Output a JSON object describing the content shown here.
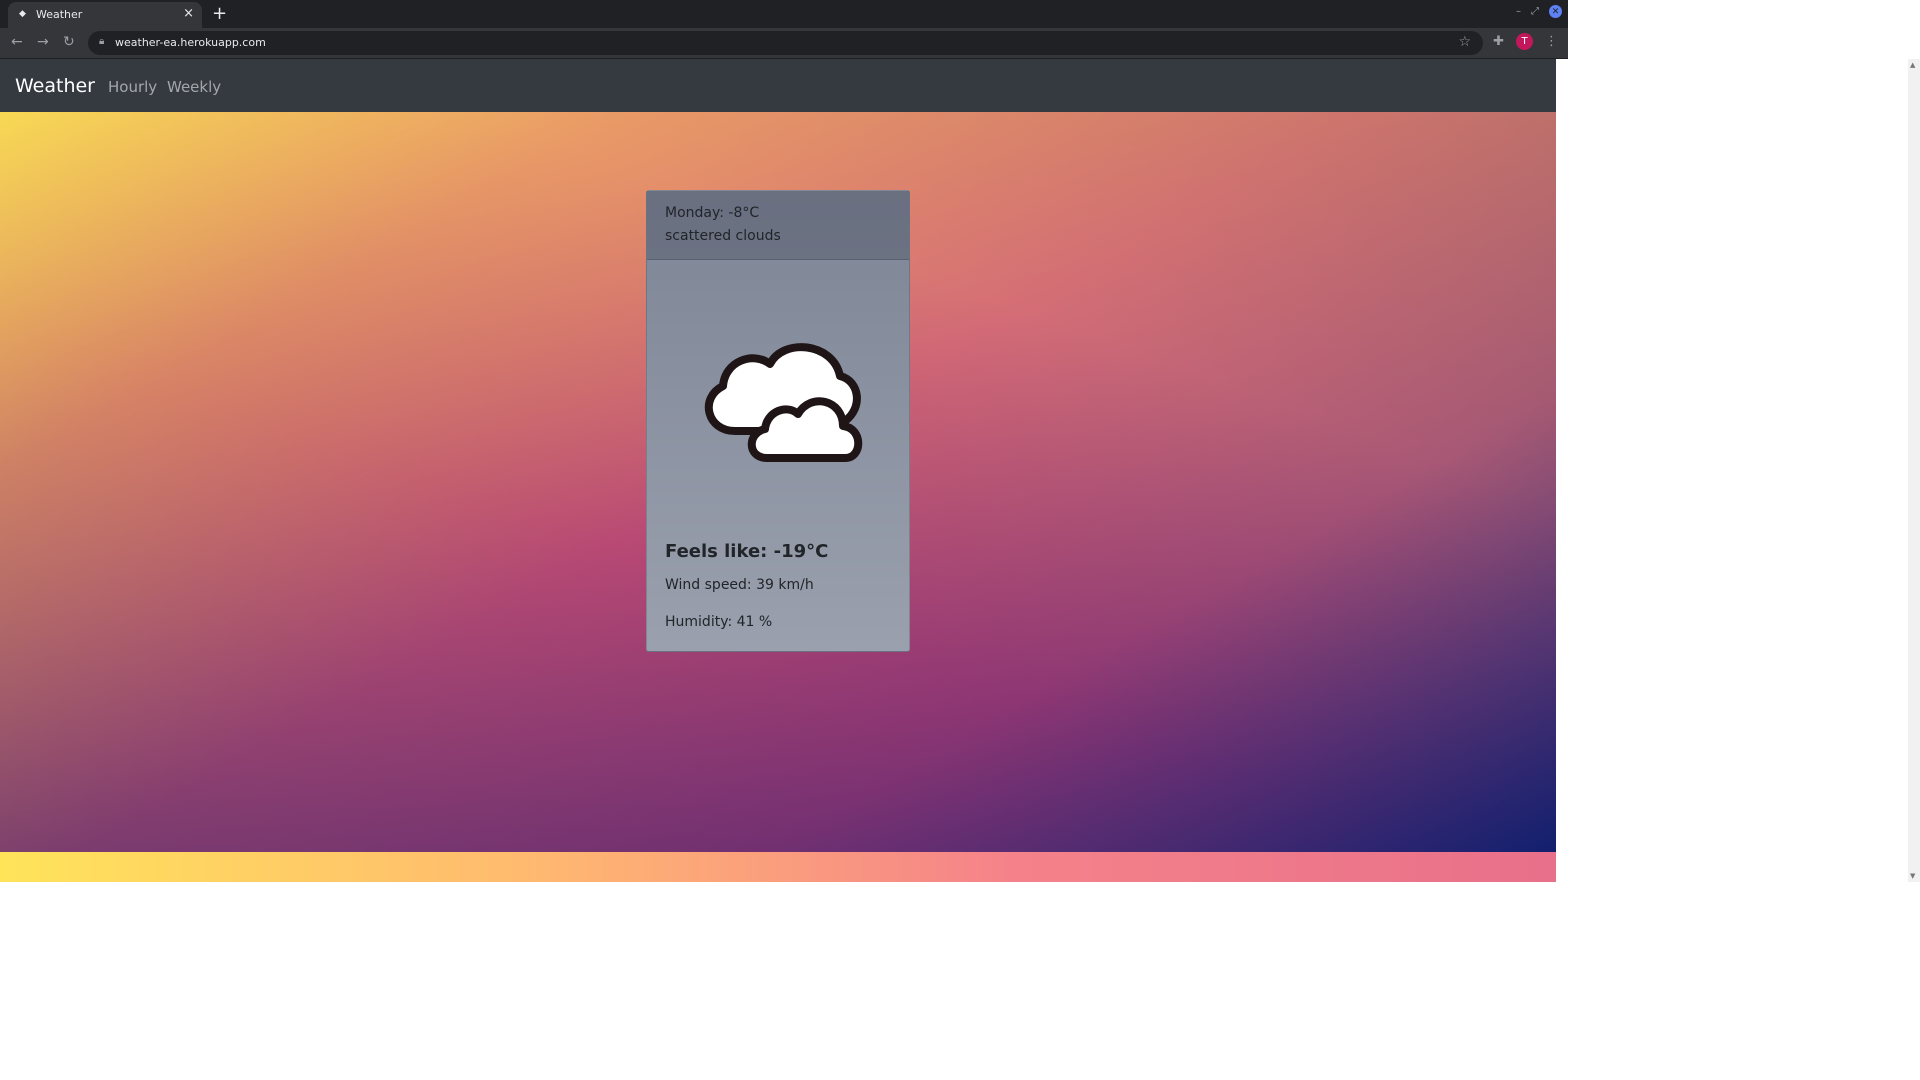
{
  "browser": {
    "tab_title": "Weather",
    "tab_close": "×",
    "new_tab": "+",
    "url": "weather-ea.herokuapp.com",
    "profile_initial": "T"
  },
  "navbar": {
    "brand": "Weather",
    "links": [
      "Hourly",
      "Weekly"
    ]
  },
  "card": {
    "day_temp": "Monday: -8°C",
    "description": "scattered clouds",
    "icon": "scattered-clouds-icon",
    "feels_like": "Feels like: -19°C",
    "wind": "Wind speed: 39 km/h",
    "humidity": "Humidity: 41 %"
  },
  "colors": {
    "navbar_bg": "#343a40",
    "chrome_bg": "#35363a",
    "avatar": "#c2185b"
  }
}
